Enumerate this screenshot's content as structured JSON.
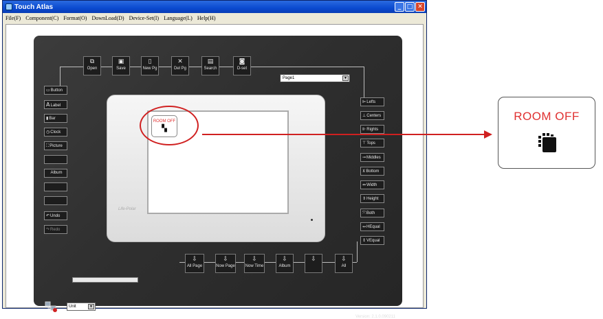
{
  "window": {
    "title": "Touch Atlas",
    "controls": {
      "minimize": "_",
      "maximize": "□",
      "close": "✕"
    }
  },
  "menu": [
    "File(F)",
    "Component(C)",
    "Format(O)",
    "DownLoad(D)",
    "Device-Set(I)",
    "Language(L)",
    "Help(H)"
  ],
  "toolbar": [
    {
      "label": "Open",
      "icon": "open-icon"
    },
    {
      "label": "Save",
      "icon": "save-icon"
    },
    {
      "label": "New Pg",
      "icon": "new-page-icon"
    },
    {
      "label": "Del Pg",
      "icon": "delete-icon"
    },
    {
      "label": "Search",
      "icon": "search-icon"
    },
    {
      "label": "D-set",
      "icon": "device-set-icon"
    }
  ],
  "page_select": {
    "value": "Page1",
    "arrow": "▼"
  },
  "left_components": [
    {
      "label": "Button",
      "icon": "button-icon"
    },
    {
      "label": "Label",
      "icon": "label-icon"
    },
    {
      "label": "Bar",
      "icon": "bar-icon"
    },
    {
      "label": "Clock",
      "icon": "clock-icon"
    },
    {
      "label": "Picture",
      "icon": "picture-icon"
    },
    {
      "label": "",
      "icon": ""
    },
    {
      "label": "Album",
      "icon": ""
    },
    {
      "label": "",
      "icon": ""
    },
    {
      "label": "",
      "icon": ""
    },
    {
      "label": "Undo",
      "icon": "undo-icon"
    },
    {
      "label": "Redo",
      "icon": "redo-icon"
    }
  ],
  "right_align": [
    {
      "label": "Lefts"
    },
    {
      "label": "Centers"
    },
    {
      "label": "Rights"
    },
    {
      "label": "Tops"
    },
    {
      "label": "Middles"
    },
    {
      "label": "Bottom"
    },
    {
      "label": "Width"
    },
    {
      "label": "Height"
    },
    {
      "label": "Both"
    },
    {
      "label": "HEqual"
    },
    {
      "label": "VEqual"
    }
  ],
  "download_buttons": [
    {
      "label": "All Page"
    },
    {
      "label": "Now Page"
    },
    {
      "label": "Now Time"
    },
    {
      "label": "Album"
    },
    {
      "label": ""
    },
    {
      "label": "All"
    }
  ],
  "device": {
    "logo": "Life-Polar"
  },
  "room_button": {
    "label": "ROOM OFF",
    "icon": "hand-press-icon"
  },
  "zoom_button": {
    "label": "ROOM OFF",
    "icon": "hand-press-icon"
  },
  "unit_select": {
    "value": "Unit",
    "arrow": "▼"
  },
  "version": "Version: 2.1.0.090211",
  "colors": {
    "accent_red": "#d02020",
    "panel": "#333333",
    "button_text": "#e03030"
  }
}
